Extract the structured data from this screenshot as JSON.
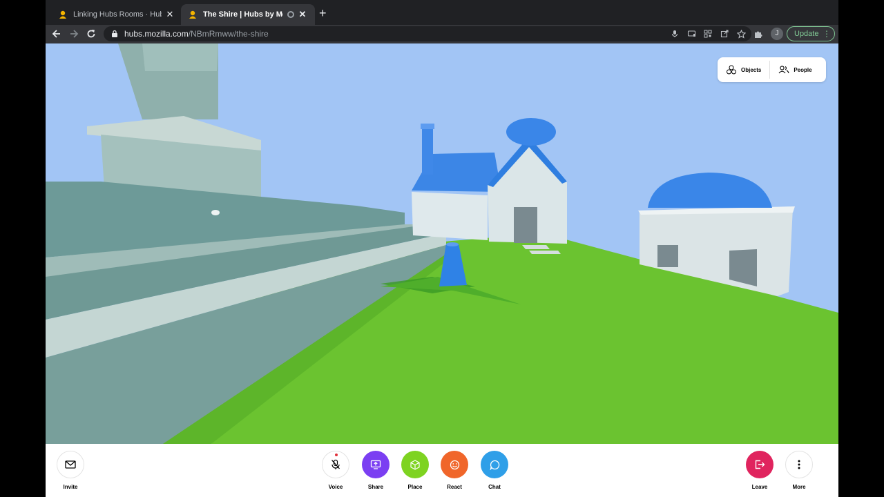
{
  "browser": {
    "tabs": [
      {
        "title": "Linking Hubs Rooms · Hubs by Mozilla",
        "active": false
      },
      {
        "title": "The Shire | Hubs by Mozilla",
        "active": true
      }
    ],
    "url_host": "hubs.mozilla.com",
    "url_path": "/NBmRmww/the-shire",
    "profile_initial": "J",
    "update_label": "Update"
  },
  "top_panel": {
    "objects_label": "Objects",
    "people_label": "People"
  },
  "toolbar": {
    "invite_label": "Invite",
    "voice_label": "Voice",
    "share_label": "Share",
    "place_label": "Place",
    "react_label": "React",
    "chat_label": "Chat",
    "leave_label": "Leave",
    "more_label": "More"
  },
  "colors": {
    "share": "#7b3ff2",
    "place": "#7ed321",
    "react": "#f0662a",
    "chat": "#2f9fe8",
    "leave": "#e0245e",
    "sky": "#a2c5f5",
    "grass": "#6bc330"
  }
}
